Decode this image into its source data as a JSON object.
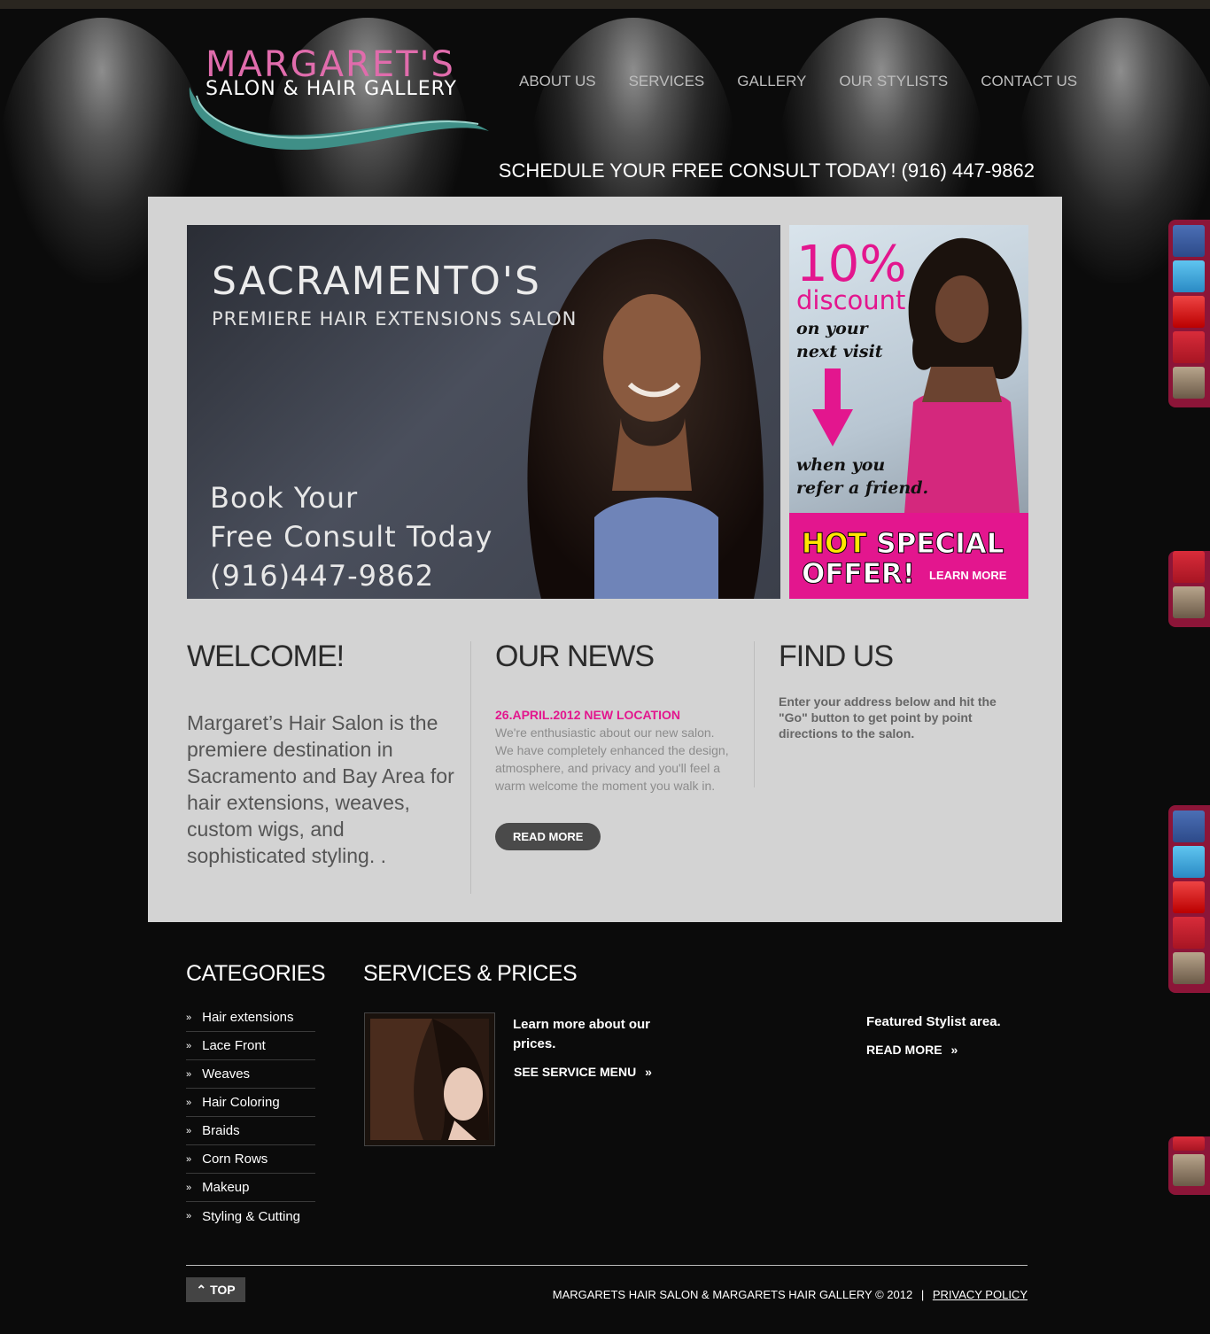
{
  "header": {
    "logo_title": "MARGARET'S",
    "logo_subtitle": "SALON & HAIR GALLERY",
    "nav": [
      "ABOUT US",
      "SERVICES",
      "GALLERY",
      "OUR STYLISTS",
      "CONTACT US"
    ],
    "consult": "SCHEDULE YOUR FREE CONSULT TODAY! (916) 447-9862"
  },
  "hero": {
    "title": "SACRAMENTO'S",
    "subtitle": "PREMIERE HAIR EXTENSIONS SALON",
    "book_line1": "Book Your",
    "book_line2": "Free Consult Today",
    "book_phone": "(916)447-9862"
  },
  "promo": {
    "percent": "10%",
    "discount": "discount",
    "next1": "on your",
    "next2": "next visit",
    "refer1": "when you",
    "refer2": "refer a friend.",
    "hot_word1": "HOT",
    "hot_word2": "SPECIAL",
    "hot_word3": "OFFER!",
    "learn_more": "LEARN MORE",
    "accent": "#e3168e"
  },
  "welcome": {
    "heading": "WELCOME!",
    "text": "Margaret’s Hair Salon is the premiere destination in Sacramento and Bay Area for hair extensions, weaves, custom wigs, and sophisticated styling. ."
  },
  "news": {
    "heading": "OUR NEWS",
    "date": "26.APRIL.2012 NEW LOCATION",
    "body": "We're enthusiastic about our new salon. We have completely enhanced the design, atmosphere, and privacy and you'll feel a warm welcome the moment you walk in.",
    "button": "READ MORE"
  },
  "find": {
    "heading": "FIND US",
    "text": "Enter your address below and hit the \"Go\" button to get point by point directions to the salon."
  },
  "footer": {
    "categories_heading": "CATEGORIES",
    "categories": [
      "Hair extensions",
      "Lace Front",
      "Weaves",
      "Hair Coloring",
      "Braids",
      "Corn Rows",
      "Makeup",
      "Styling & Cutting"
    ],
    "services_heading": "SERVICES & PRICES",
    "services_text": "Learn more about our prices.",
    "services_link": "SEE SERVICE MENU",
    "featured_text": "Featured Stylist area.",
    "featured_link": "READ MORE",
    "top_button": "TOP",
    "copyright": "MARGARETS HAIR SALON & MARGARETS HAIR GALLERY © 2012",
    "separator": "|",
    "privacy": "PRIVACY POLICY"
  },
  "social_icons": [
    "facebook-icon",
    "twitter-icon",
    "youtube-icon",
    "pinterest-icon",
    "instagram-icon"
  ]
}
